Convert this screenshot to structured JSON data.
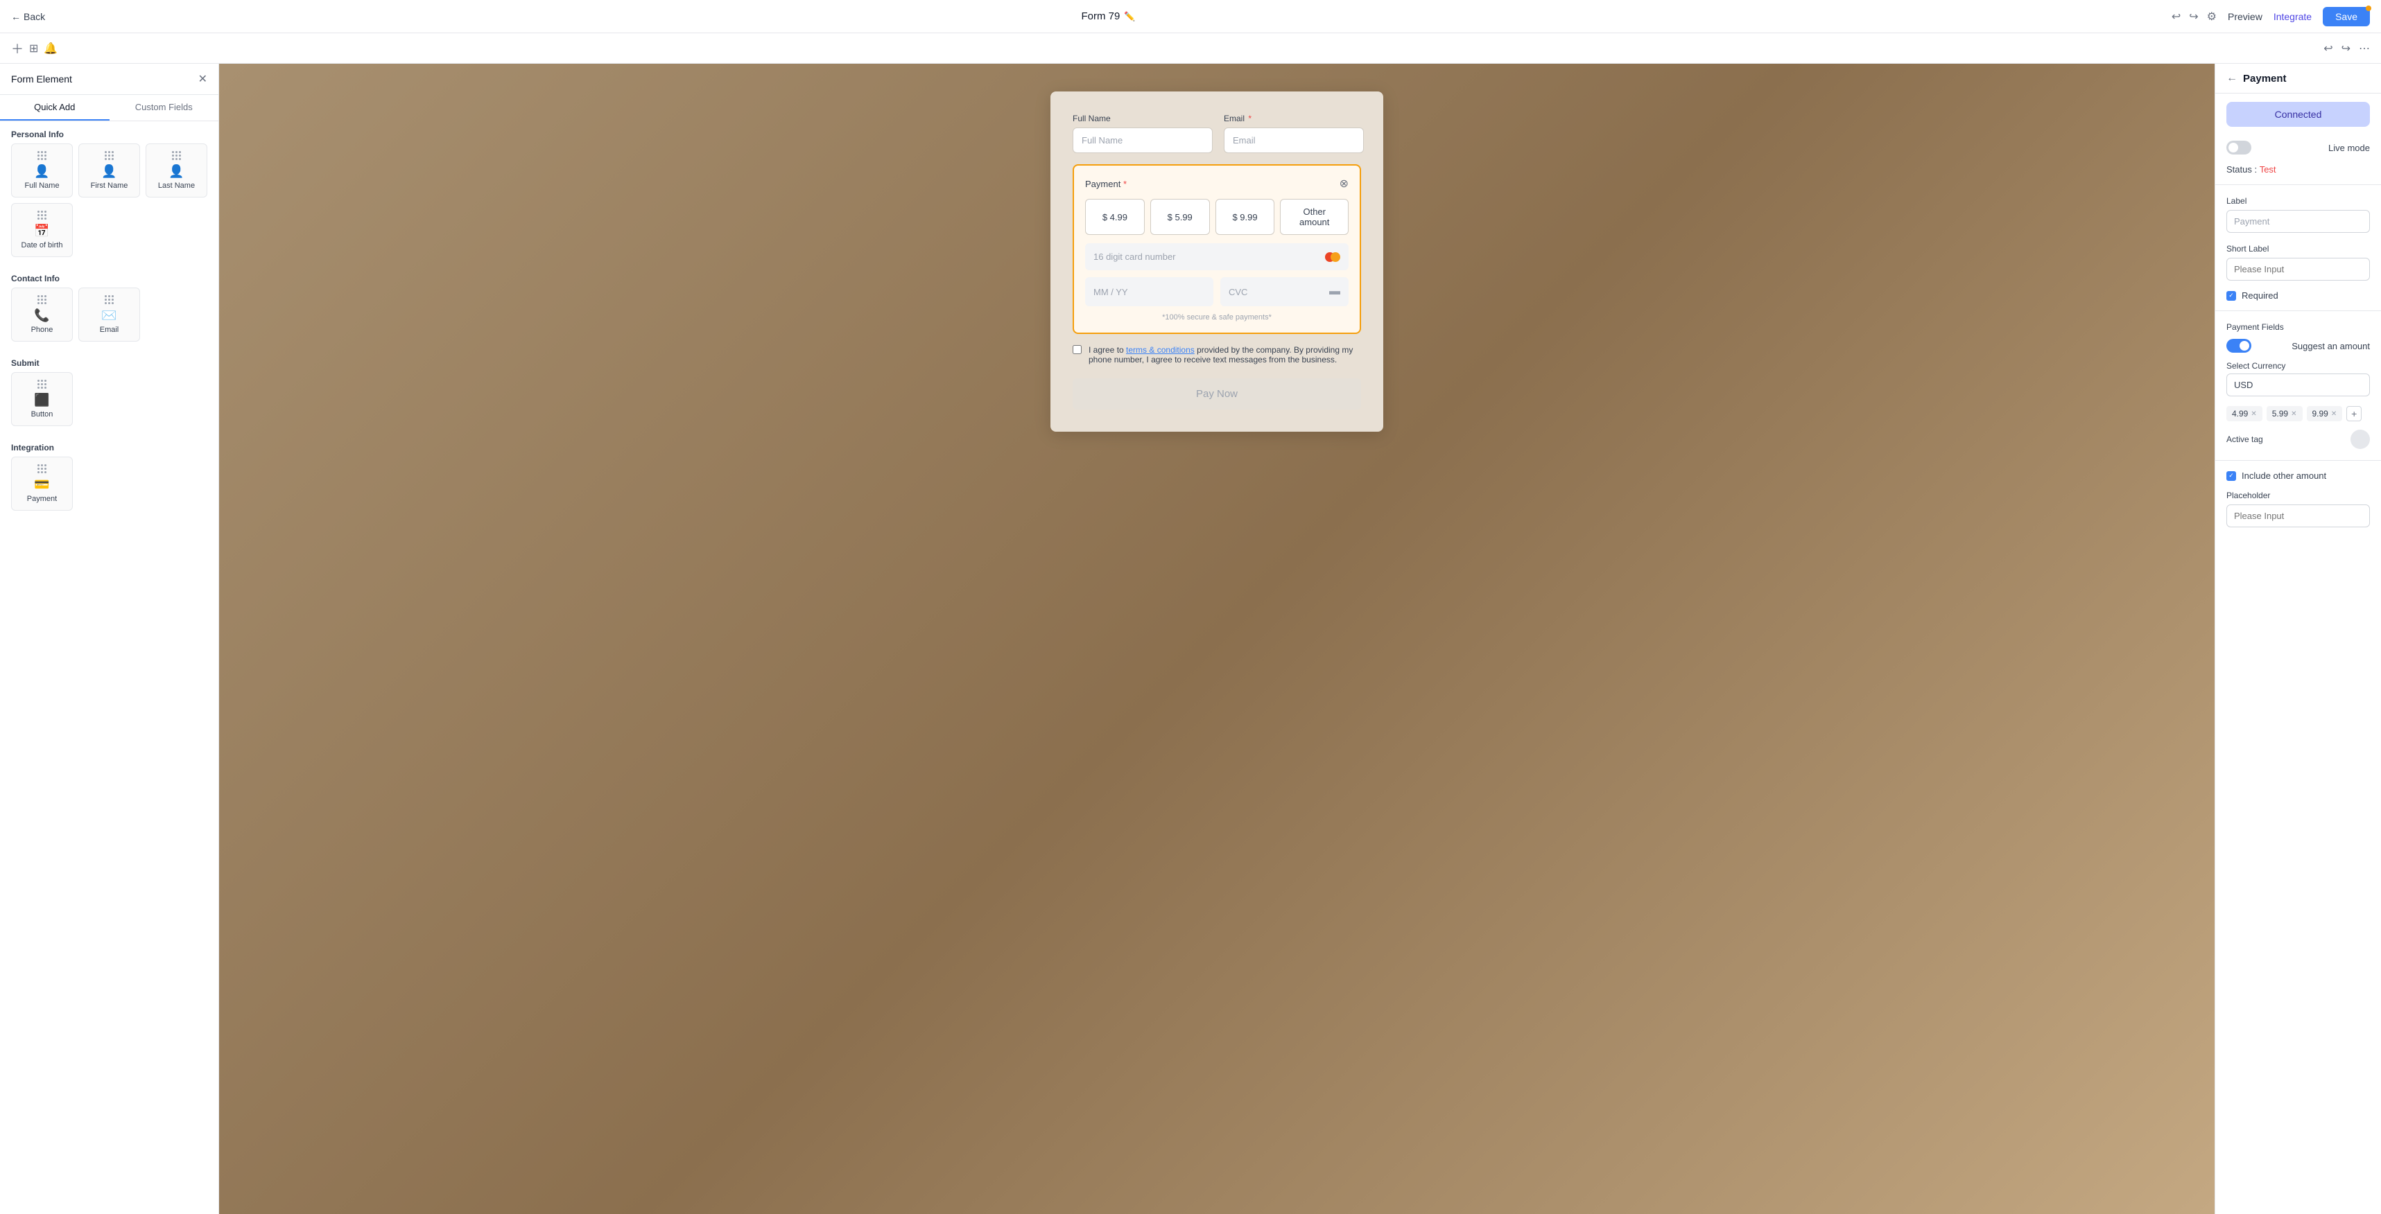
{
  "topbar": {
    "back_label": "Back",
    "title": "Form 79",
    "preview_label": "Preview",
    "integrate_label": "Integrate",
    "save_label": "Save"
  },
  "left_panel": {
    "title": "Form Element",
    "tab_quick": "Quick Add",
    "tab_custom": "Custom Fields",
    "sections": [
      {
        "name": "Personal Info",
        "items": [
          {
            "label": "Full Name",
            "icon": "👤"
          },
          {
            "label": "First Name",
            "icon": "👤"
          },
          {
            "label": "Last Name",
            "icon": "👤"
          },
          {
            "label": "Date of birth",
            "icon": "📅"
          }
        ]
      },
      {
        "name": "Contact Info",
        "items": [
          {
            "label": "Phone",
            "icon": "📞"
          },
          {
            "label": "Email",
            "icon": "✉️"
          }
        ]
      },
      {
        "name": "Submit",
        "items": [
          {
            "label": "Button",
            "icon": "⬛"
          }
        ]
      },
      {
        "name": "Integration",
        "items": [
          {
            "label": "Payment",
            "icon": "💳"
          }
        ]
      }
    ]
  },
  "form": {
    "full_name_label": "Full Name",
    "full_name_placeholder": "Full Name",
    "email_label": "Email",
    "email_placeholder": "Email",
    "payment_label": "Payment",
    "amount_1": "$ 4.99",
    "amount_2": "$ 5.99",
    "amount_3": "$ 9.99",
    "other_amount": "Other amount",
    "card_placeholder": "16 digit card number",
    "mm_placeholder": "MM / YY",
    "cvc_placeholder": "CVC",
    "secure_text": "*100% secure & safe payments*",
    "terms_text": "I agree to ",
    "terms_link": "terms & conditions",
    "terms_rest": " provided by the company. By providing my phone number, I agree to receive text messages from the business.",
    "pay_btn": "Pay Now"
  },
  "right_panel": {
    "title": "Payment",
    "connected_label": "Connected",
    "live_mode_label": "Live mode",
    "status_label": "Status :",
    "status_value": "Test",
    "label_field": "Label",
    "label_value": "Payment",
    "short_label": "Short Label",
    "short_placeholder": "Please Input",
    "required_label": "Required",
    "payment_fields": "Payment Fields",
    "suggest_label": "Suggest an amount",
    "currency_label": "Select Currency",
    "currency_value": "USD",
    "amount_tags": [
      "4.99",
      "5.99",
      "9.99"
    ],
    "active_tag_label": "Active tag",
    "include_other_label": "Include other amount",
    "placeholder_label": "Placeholder",
    "placeholder_value": "Please Input"
  }
}
